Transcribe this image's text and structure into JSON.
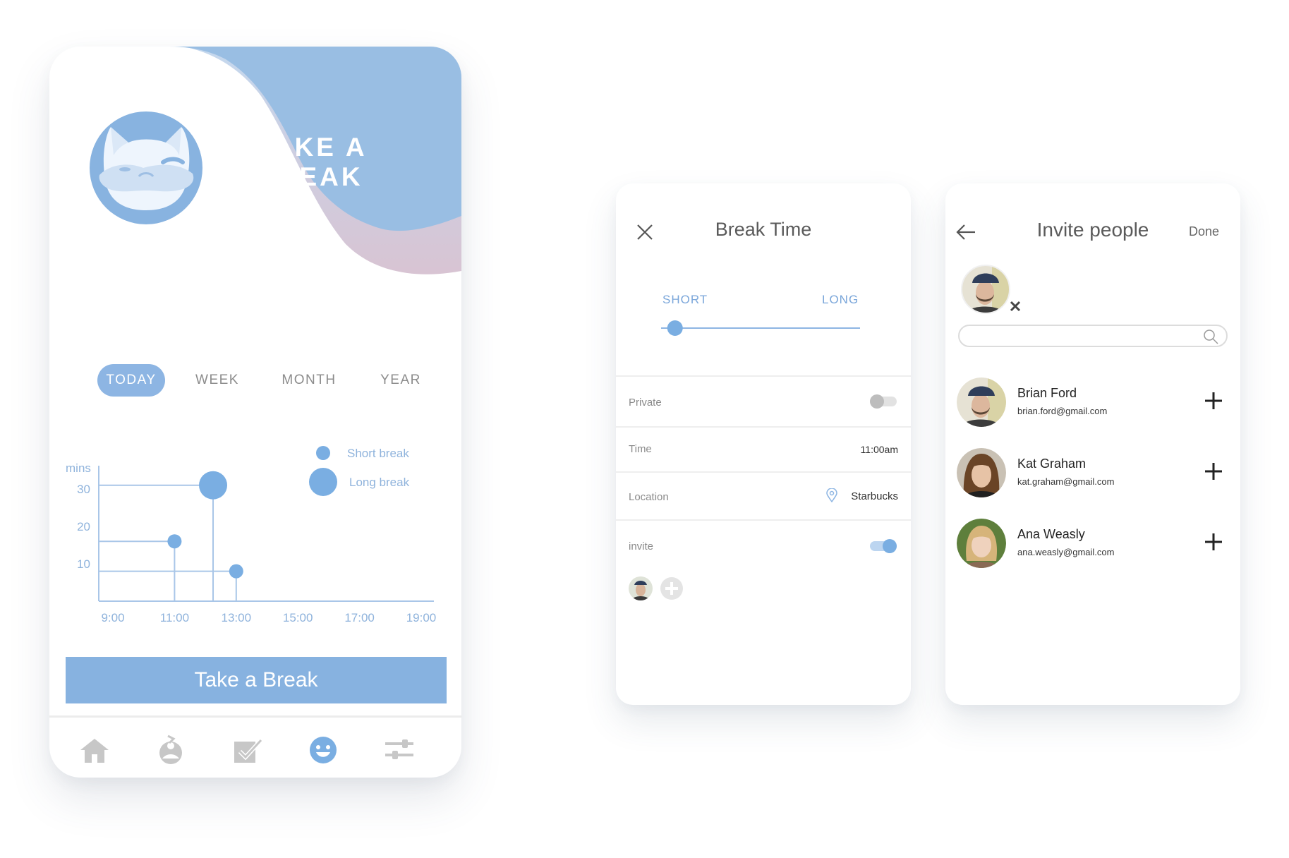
{
  "break_screen": {
    "hero_title": "TAKE A BREAK",
    "tabs": [
      {
        "label": "TODAY",
        "active": true
      },
      {
        "label": "WEEK",
        "active": false
      },
      {
        "label": "MONTH",
        "active": false
      },
      {
        "label": "YEAR",
        "active": false
      }
    ],
    "cta_label": "Take a Break",
    "nav_icons": [
      "home-icon",
      "meditation-icon",
      "checklist-icon",
      "smiley-icon",
      "sliders-icon"
    ],
    "active_nav": "smiley-icon",
    "colors": {
      "accent": "#8db5e3",
      "text_muted": "#8c8c8c"
    }
  },
  "chart_data": {
    "type": "scatter",
    "ylabel": "mins",
    "y_ticks": [
      "30",
      "20",
      "10"
    ],
    "x_ticks": [
      "9:00",
      "11:00",
      "13:00",
      "15:00",
      "17:00",
      "19:00"
    ],
    "legend": [
      {
        "name": "Short break",
        "size": "small"
      },
      {
        "name": "Long break",
        "size": "large"
      }
    ],
    "legend_position": "top-right",
    "points": [
      {
        "time": "11:00",
        "minutes": 16,
        "series": "Short break"
      },
      {
        "time": "12:15",
        "minutes": 31,
        "series": "Long break"
      },
      {
        "time": "13:00",
        "minutes": 8,
        "series": "Short break"
      }
    ],
    "ylim": [
      0,
      36
    ],
    "grid": false
  },
  "break_time_screen": {
    "title": "Break Time",
    "slider": {
      "left_label": "SHORT",
      "right_label": "LONG",
      "value": 0.07
    },
    "rows": {
      "private_label": "Private",
      "private_on": false,
      "time_label": "Time",
      "time_value": "11:00am",
      "location_label": "Location",
      "location_value": "Starbucks",
      "invite_label": "invite",
      "invite_on": true
    }
  },
  "invite_screen": {
    "title": "Invite people",
    "done_label": "Done",
    "search_placeholder": "",
    "people": [
      {
        "name": "Brian Ford",
        "email": "brian.ford@gmail.com"
      },
      {
        "name": "Kat Graham",
        "email": "kat.graham@gmail.com"
      },
      {
        "name": "Ana Weasly",
        "email": "ana.weasly@gmail.com"
      }
    ]
  }
}
